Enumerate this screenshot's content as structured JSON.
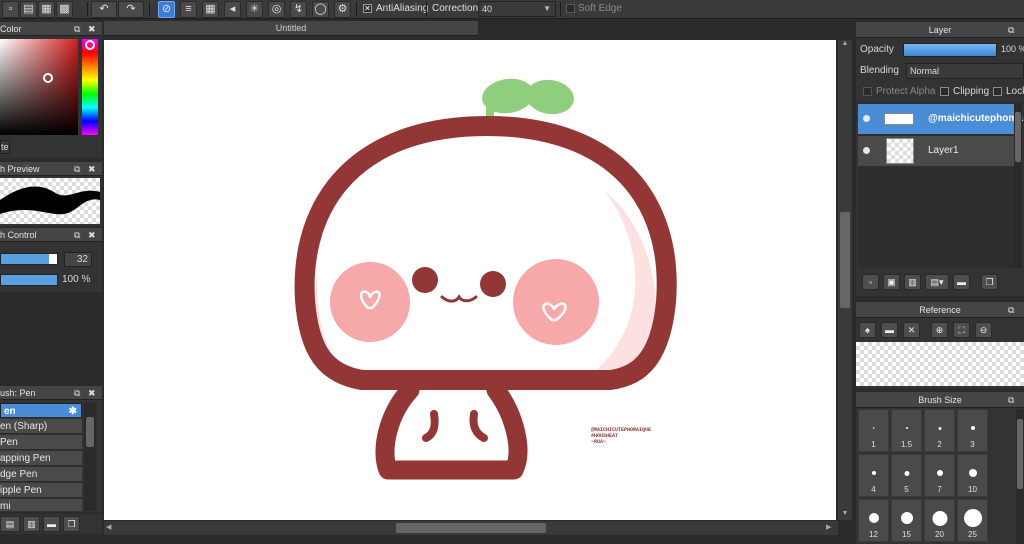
{
  "toolbar": {
    "antialias_label": "AntiAliasing",
    "antialias_checked": true,
    "correction_label": "Correction",
    "correction_value": "40",
    "soft_edge_label": "Soft Edge",
    "soft_edge_checked": false
  },
  "color_panel": {
    "title": "Color",
    "bottom_label": "te"
  },
  "brush_preview": {
    "title": "h Preview"
  },
  "brush_control": {
    "title": "h Control",
    "size_value": "32",
    "opacity_value": "100 %",
    "size_fill": 0.85,
    "opacity_fill": 1.0
  },
  "brush_list": {
    "title": "ush: Pen",
    "items": [
      {
        "label": "en",
        "selected": true
      },
      {
        "label": "en (Sharp)",
        "selected": false
      },
      {
        "label": "Pen",
        "selected": false
      },
      {
        "label": "apping Pen",
        "selected": false
      },
      {
        "label": "dge Pen",
        "selected": false
      },
      {
        "label": "ipple Pen",
        "selected": false
      },
      {
        "label": "mi",
        "selected": false
      }
    ]
  },
  "document": {
    "tab_title": "Untitled"
  },
  "artwork": {
    "credit_line1": "@MAICHICUTEPHOMAIQUE",
    "credit_line2": "#HOUSHEAT",
    "credit_line3": "~RUA~",
    "body_color": "#933636",
    "cheek_color": "#f7a8a8",
    "leaf_color": "#8fce7c"
  },
  "layer_panel": {
    "title": "Layer",
    "opacity_label": "Opacity",
    "opacity_value": "100 %",
    "opacity_fill": 1.0,
    "blending_label": "Blending",
    "blending_value": "Normal",
    "protect_alpha_label": "Protect Alpha",
    "clipping_label": "Clipping",
    "lock_label": "Lock",
    "layers": [
      {
        "name": "@maichicutephoma",
        "selected": true
      },
      {
        "name": "Layer1",
        "selected": false
      }
    ]
  },
  "reference_panel": {
    "title": "Reference"
  },
  "brush_size_panel": {
    "title": "Brush Size",
    "sizes": [
      "1",
      "1.5",
      "2",
      "3",
      "4",
      "5",
      "7",
      "10",
      "12",
      "15",
      "20",
      "25"
    ]
  }
}
